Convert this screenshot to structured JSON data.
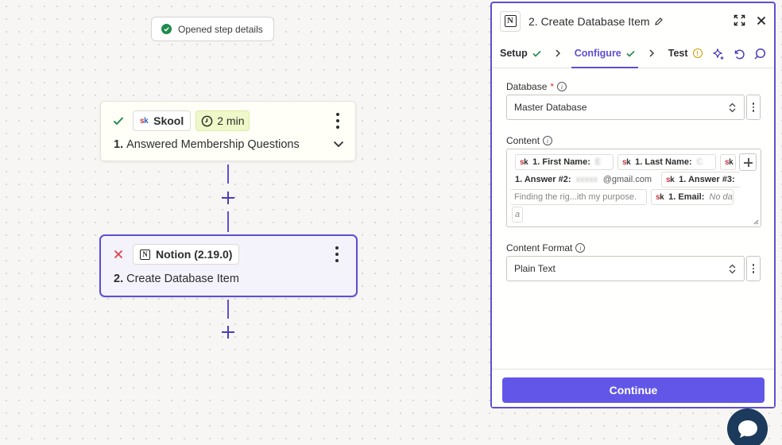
{
  "toast": {
    "text": "Opened step details"
  },
  "steps": [
    {
      "app": "Skool",
      "app_logo": "sk",
      "delay": "2 min",
      "number": "1.",
      "title": "Answered Membership Questions",
      "status": "success"
    },
    {
      "app": "Notion (2.19.0)",
      "app_logo": "N",
      "number": "2.",
      "title": "Create Database Item",
      "status": "error"
    }
  ],
  "panel": {
    "title": "2. Create Database Item",
    "tabs": [
      {
        "label": "Setup",
        "state": "done"
      },
      {
        "label": "Configure",
        "state": "done-active"
      },
      {
        "label": "Test",
        "state": "warning"
      }
    ],
    "database": {
      "label": "Database",
      "required_mark": "*",
      "value": "Master Database"
    },
    "content": {
      "label": "Content",
      "tokens": {
        "first_name_label": "1. First Name:",
        "first_name_value": "E",
        "last_name_label": "1. Last Name:",
        "last_name_value": "C",
        "answer2_label": "1. Answer #2:",
        "answer2_value": "@gmail.com",
        "answer3_label": "1. Answer #3:",
        "answer3_value": "Finding the rig...ith my purpose.",
        "email_label": "1. Email:",
        "email_value": "No dat",
        "wrap_value": "a"
      }
    },
    "content_format": {
      "label": "Content Format",
      "value": "Plain Text"
    },
    "continue_label": "Continue"
  },
  "colors": {
    "accent": "#5e4fd1",
    "button": "#6256e8",
    "success": "#1f8b4c",
    "error": "#e0434b",
    "warning": "#d19a00",
    "chat": "#1b3a5c"
  }
}
